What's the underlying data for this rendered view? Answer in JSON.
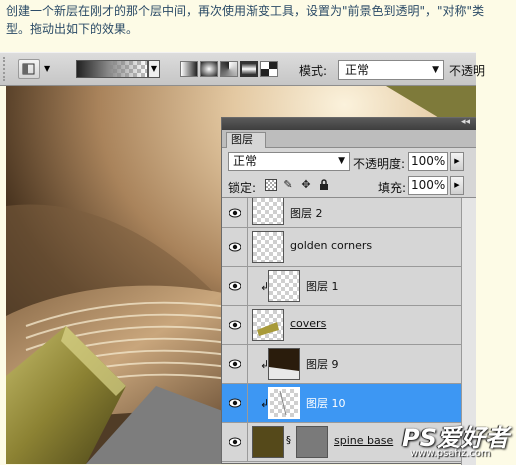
{
  "intro": {
    "line1": "创建一个新层在刚才的那个层中间，再次使用渐变工具，设置为\"前景色到透明\"，\"对称\"类",
    "line2": "型。拖动出如下的效果。"
  },
  "options_bar": {
    "mode_label": "模式:",
    "mode_value": "正常",
    "opacity_label": "不透明"
  },
  "layers_panel": {
    "tab_label": "图层",
    "blend_mode": "正常",
    "opacity_label": "不透明度:",
    "opacity_value": "100%",
    "lock_label": "锁定:",
    "fill_label": "填充:",
    "fill_value": "100%",
    "layers": [
      {
        "name": "图层 2"
      },
      {
        "name": "golden corners"
      },
      {
        "name": "图层 1"
      },
      {
        "name": "covers"
      },
      {
        "name": "图层 9"
      },
      {
        "name": "图层 10"
      },
      {
        "name": "spine base"
      }
    ]
  },
  "watermark": {
    "brand": "PS爱好者",
    "url": "www.psahz.com"
  },
  "colors": {
    "selection": "#3d97f3",
    "panel_bg": "#d6d6d6",
    "page_bg": "#fdfbe6"
  }
}
